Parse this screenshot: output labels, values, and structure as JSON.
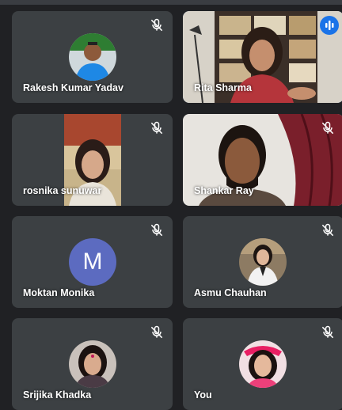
{
  "participants": [
    {
      "name": "Rakesh Kumar Yadav",
      "muted": true,
      "video": false
    },
    {
      "name": "Rita Sharma",
      "muted": false,
      "video": true,
      "speaking": true
    },
    {
      "name": "rosnika sunuwar",
      "muted": true,
      "video": true
    },
    {
      "name": "Shankar Ray",
      "muted": true,
      "video": true
    },
    {
      "name": "Moktan Monika",
      "muted": true,
      "video": false,
      "initial": "M"
    },
    {
      "name": "Asmu Chauhan",
      "muted": true,
      "video": false
    },
    {
      "name": "Srijika Khadka",
      "muted": true,
      "video": false
    },
    {
      "name": "You",
      "muted": true,
      "video": false
    }
  ],
  "colors": {
    "background": "#202124",
    "tile": "#3c4043",
    "speaking_outline": "#8ab4f8",
    "speaking_badge": "#1a73e8",
    "letter_avatar": "#5c6bc0"
  },
  "icons": {
    "muted": "mic-off-icon",
    "speaking": "audio-level-icon"
  }
}
